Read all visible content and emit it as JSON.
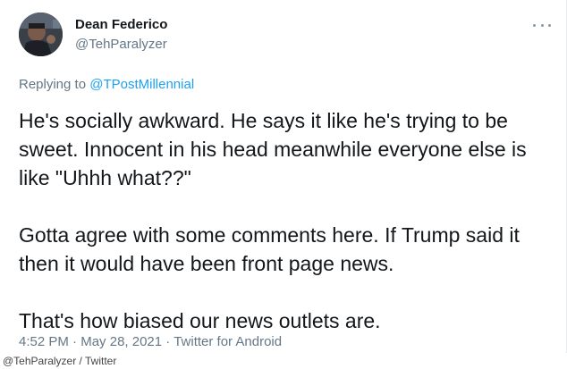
{
  "tweet": {
    "display_name": "Dean Federico",
    "handle": "@TehParalyzer",
    "replying_prefix": "Replying to",
    "replying_to": "@TPostMillennial",
    "paragraphs": [
      "He's socially awkward. He says it like he's trying to be sweet. Innocent in his head meanwhile everyone else is like \"Uhhh what??\"",
      "Gotta agree with some comments here. If Trump said it then it would have been front page news.",
      "That's how biased our news outlets are."
    ],
    "time": "4:52 PM",
    "date": "May 28, 2021",
    "source": "Twitter for Android",
    "separator": "·"
  },
  "credit": "@TehParalyzer / Twitter",
  "icons": {
    "more": "more-options-icon",
    "avatar": "avatar"
  },
  "colors": {
    "link": "#1da1f2",
    "muted": "#657786",
    "text": "#14171a"
  }
}
